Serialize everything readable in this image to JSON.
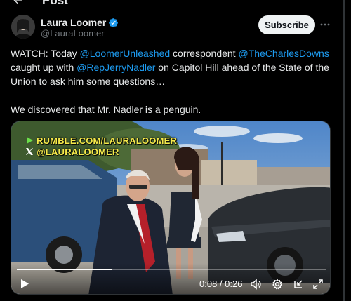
{
  "header": {
    "title": "Post",
    "back_icon": "arrow-left-icon"
  },
  "author": {
    "display_name": "Laura Loomer",
    "handle": "@LauraLoomer",
    "verified": true,
    "verified_color": "#1d9bf0"
  },
  "actions": {
    "subscribe_label": "Subscribe",
    "more_icon": "more-icon"
  },
  "tweet": {
    "p1_pre": "WATCH: Today ",
    "p1_m1": "@LoomerUnleashed",
    "p1_mid1": " correspondent ",
    "p1_m2": "@TheCharlesDowns",
    "p1_mid2": " caught up with ",
    "p1_m3": "@RepJerryNadler",
    "p1_post": " on Capitol Hill ahead of the State of the Union to ask him some questions…",
    "p2": "We discovered that Mr. Nadler is a penguin."
  },
  "video": {
    "watermark_line1": "RUMBLE.COM/LAURALOOMER",
    "watermark_line2": "@LAURALOOMER",
    "current_time": "0:08",
    "separator": " / ",
    "duration": "0:26",
    "progress_fraction": 0.31
  },
  "colors": {
    "link": "#1d9bf0",
    "text": "#e7e9ea",
    "muted": "#71767b",
    "background": "#000000"
  }
}
